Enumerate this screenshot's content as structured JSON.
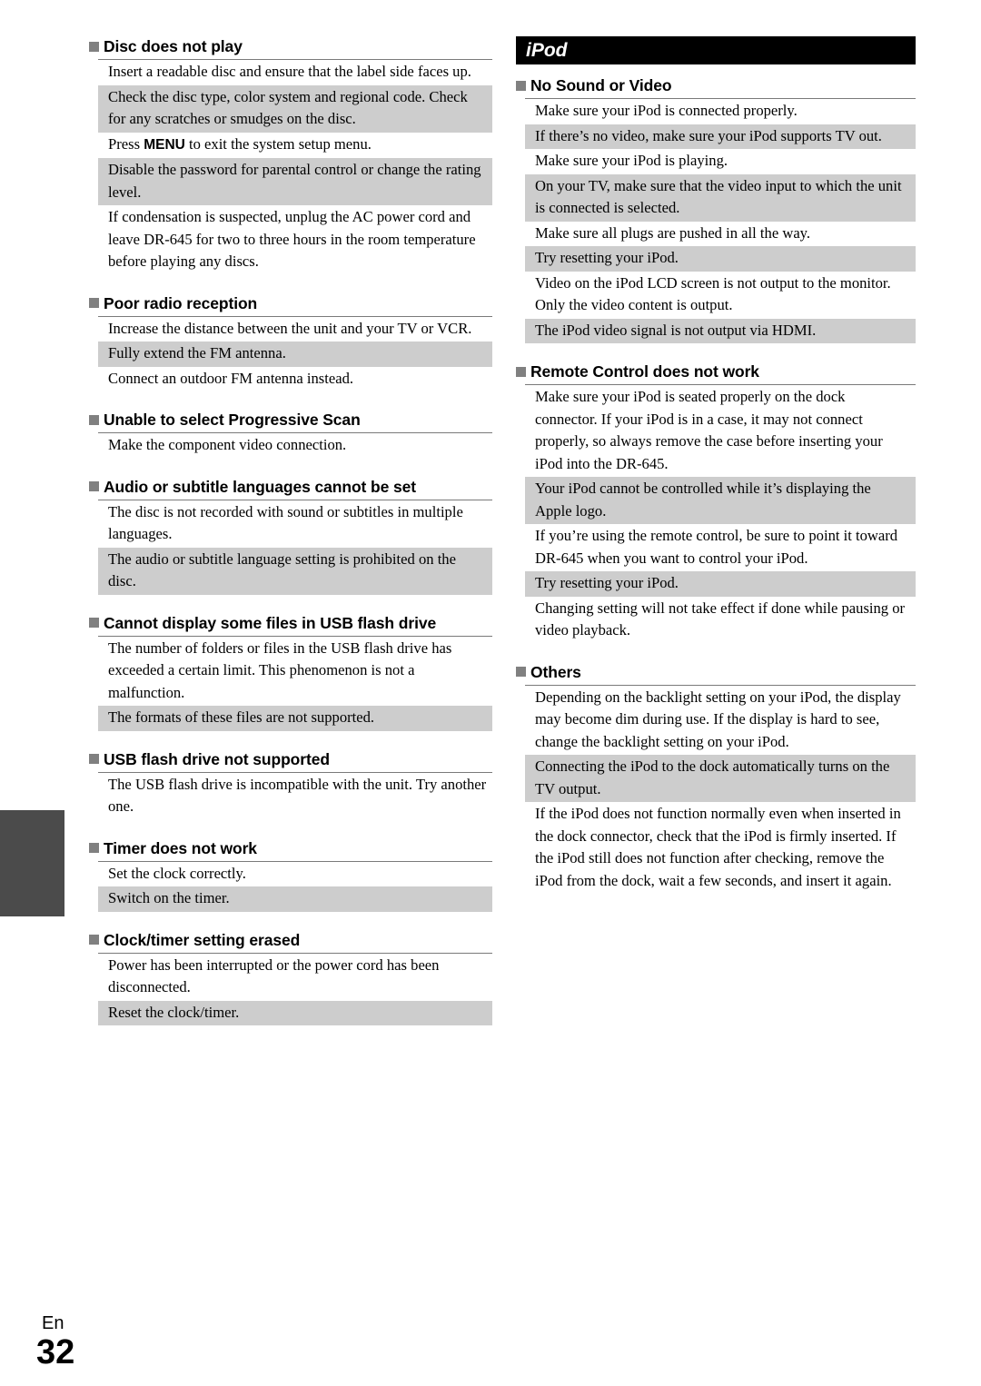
{
  "page": {
    "language_label": "En",
    "page_number": "32",
    "shade_color": "#cdcdcd",
    "bullet_color": "#808080",
    "banner_color": "#000000",
    "tab_color": "#4b4b4b"
  },
  "left_column": {
    "sections": [
      {
        "heading": "Disc does not play",
        "rows": [
          {
            "text": "Insert a readable disc and ensure that the label side faces up.",
            "shaded": false
          },
          {
            "text": "Check the disc type, color system and regional code. Check for any scratches or smudges on the disc.",
            "shaded": true
          },
          {
            "rich": true,
            "pre": "Press ",
            "strong": "MENU",
            "post": " to exit the system setup menu.",
            "shaded": false
          },
          {
            "text": "Disable the password for parental control or change the rating level.",
            "shaded": true
          },
          {
            "text": "If condensation is suspected, unplug the AC power cord and leave DR-645 for two to three hours in the room temperature before playing any discs.",
            "shaded": false
          }
        ]
      },
      {
        "heading": "Poor radio reception",
        "rows": [
          {
            "text": "Increase the distance between the unit and your TV or VCR.",
            "shaded": false
          },
          {
            "text": "Fully extend the FM antenna.",
            "shaded": true
          },
          {
            "text": "Connect an outdoor FM antenna instead.",
            "shaded": false
          }
        ]
      },
      {
        "heading": "Unable to select Progressive Scan",
        "rows": [
          {
            "text": "Make the component video connection.",
            "shaded": false
          }
        ]
      },
      {
        "heading": "Audio or subtitle languages cannot be set",
        "rows": [
          {
            "text": "The disc is not recorded with sound or subtitles in multiple languages.",
            "shaded": false
          },
          {
            "text": "The audio or subtitle language setting is prohibited on the disc.",
            "shaded": true
          }
        ]
      },
      {
        "heading": "Cannot display some files in USB flash drive",
        "rows": [
          {
            "text": "The number of folders or files in the USB flash drive has exceeded a certain limit. This phenomenon is not a malfunction.",
            "shaded": false
          },
          {
            "text": "The formats of these files are not supported.",
            "shaded": true
          }
        ]
      },
      {
        "heading": "USB flash drive not supported",
        "rows": [
          {
            "text": "The USB flash drive is incompatible with the unit. Try another one.",
            "shaded": false
          }
        ]
      },
      {
        "heading": "Timer does not work",
        "rows": [
          {
            "text": "Set the clock correctly.",
            "shaded": false
          },
          {
            "text": "Switch on the timer.",
            "shaded": true
          }
        ]
      },
      {
        "heading": "Clock/timer setting erased",
        "rows": [
          {
            "text": "Power has been interrupted or the power cord has been disconnected.",
            "shaded": false
          },
          {
            "text": "Reset the clock/timer.",
            "shaded": true
          }
        ]
      }
    ]
  },
  "right_column": {
    "banner": "iPod",
    "sections": [
      {
        "heading": "No Sound or Video",
        "rows": [
          {
            "text": "Make sure your iPod is connected properly.",
            "shaded": false
          },
          {
            "text": "If there’s no video, make sure your iPod supports TV out.",
            "shaded": true
          },
          {
            "text": "Make sure your iPod is playing.",
            "shaded": false
          },
          {
            "text": "On your TV, make sure that the video input to which the unit is connected is selected.",
            "shaded": true
          },
          {
            "text": "Make sure all plugs are pushed in all the way.",
            "shaded": false
          },
          {
            "text": "Try resetting your iPod.",
            "shaded": true
          },
          {
            "text": "Video on the iPod LCD screen is not output to the monitor. Only the video content is output.",
            "shaded": false
          },
          {
            "text": "The iPod video signal is not output via HDMI.",
            "shaded": true
          }
        ]
      },
      {
        "heading": "Remote Control does not work",
        "rows": [
          {
            "text": "Make sure your iPod is seated properly on the dock connector. If your iPod is in a case, it may not connect properly, so always remove the case before inserting your iPod into the DR-645.",
            "shaded": false
          },
          {
            "text": "Your iPod cannot be controlled while it’s displaying the Apple logo.",
            "shaded": true
          },
          {
            "text": "If you’re using the remote control, be sure to point it toward DR-645 when you want to control your iPod.",
            "shaded": false
          },
          {
            "text": "Try resetting your iPod.",
            "shaded": true
          },
          {
            "text": "Changing setting will not take effect if done while pausing or video playback.",
            "shaded": false
          }
        ]
      },
      {
        "heading": "Others",
        "rows": [
          {
            "text": "Depending on the backlight setting on your iPod, the display may become dim during use. If the display is hard to see, change the backlight setting on your iPod.",
            "shaded": false
          },
          {
            "text": "Connecting the iPod to the dock automatically turns on the TV output.",
            "shaded": true
          },
          {
            "text": "If the iPod does not function normally even when inserted in the dock connector, check that the iPod is firmly inserted. If the iPod still does not function after checking, remove the iPod from the dock, wait a few seconds, and insert it again.",
            "shaded": false
          }
        ]
      }
    ]
  }
}
